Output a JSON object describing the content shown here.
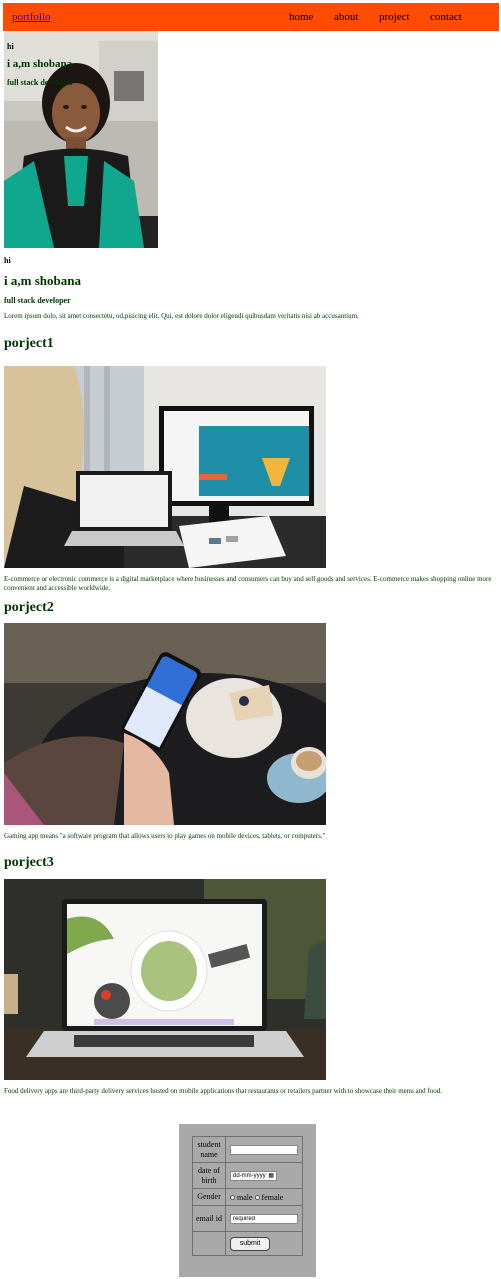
{
  "nav": {
    "brand": "portfolio",
    "links": [
      "home",
      "about",
      "project",
      "contact"
    ]
  },
  "hero": {
    "greeting": "hi",
    "name": "i a,m shobana",
    "role": "full stack developer"
  },
  "about": {
    "greeting": "hi",
    "name": "i a,m shobana",
    "role": "full stack developer",
    "text": "Lorem ipsum dolo, sit amet consectetu, od,pisicing elit. Qui, est dolore dolor eligendi quibusdam veritatis nisi ab accusantium."
  },
  "projects": [
    {
      "title": "porject1",
      "description": "E-commerce or electronic commerce is a digital marketplace where businesses and consumers can buy and sell goods and services. E-commerce makes shopping online more convenient and accessible worldwide."
    },
    {
      "title": "porject2",
      "description": "Gaming app means \"a software program that allows users to play games on mobile devices, tablets, or computers.\""
    },
    {
      "title": "porject3",
      "description": "Food delivery apps are third-party delivery services hosted on mobile applications that restaurants or retailers partner with to showcase their menu and food."
    }
  ],
  "form": {
    "student_name_label": "student name",
    "dob_label": "date of birth",
    "dob_placeholder": "dd-mm-yyyy",
    "gender_label": "Gender",
    "male_label": "male",
    "female_label": "female",
    "email_label": "email id",
    "email_value": "required",
    "submit_label": "submit"
  },
  "colors": {
    "nav_background": "#ff4c00",
    "heading_text": "#003300",
    "form_background": "#a9a9a9"
  }
}
